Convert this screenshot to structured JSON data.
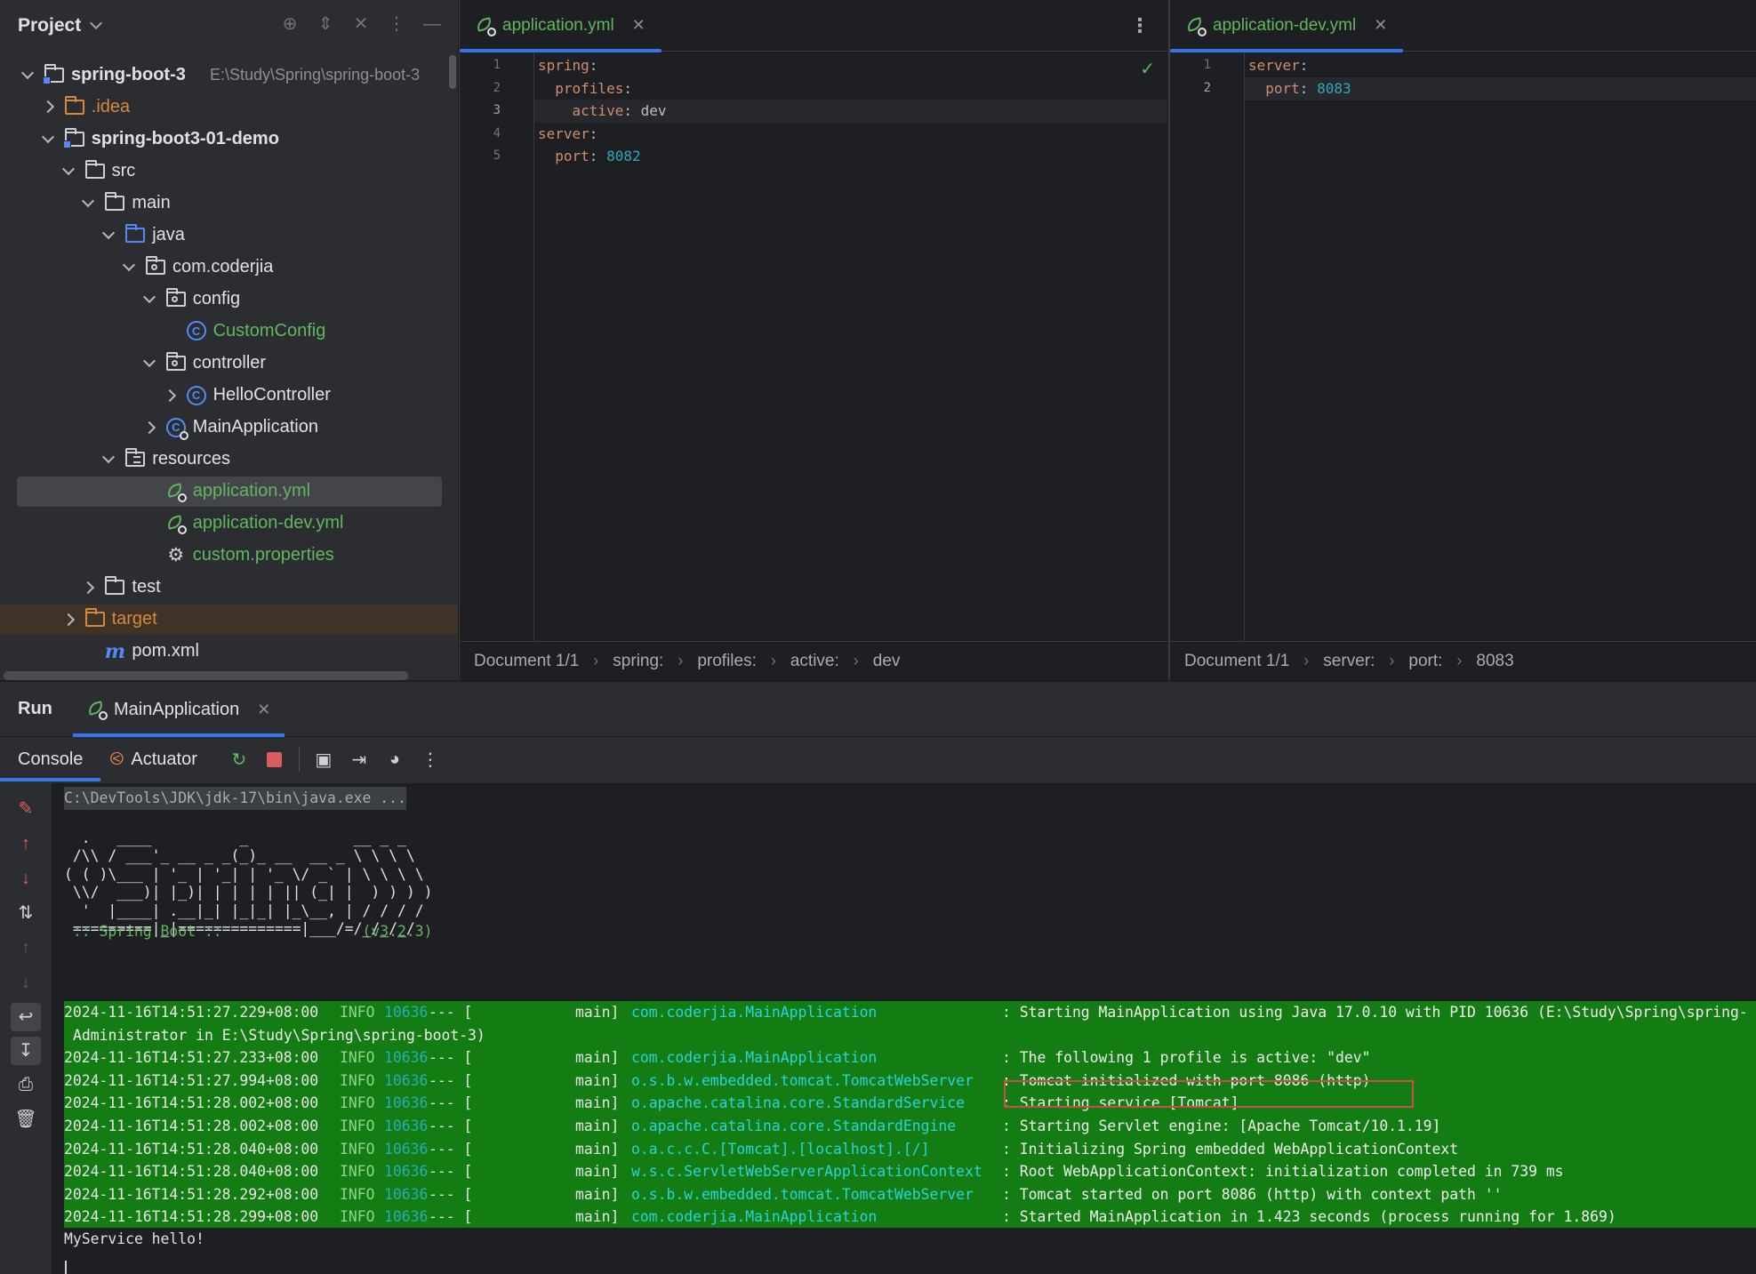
{
  "project": {
    "title": "Project",
    "tree": [
      {
        "label": "spring-boot-3",
        "hint": "E:\\Study\\Spring\\spring-boot-3",
        "depth": 0,
        "arrow": "down",
        "icon": "module-folder-icon",
        "color": "#dfe1e5",
        "bold": true
      },
      {
        "label": ".idea",
        "depth": 1,
        "arrow": "right",
        "icon": "folder-icon",
        "color": "#d5893c"
      },
      {
        "label": "spring-boot3-01-demo",
        "depth": 1,
        "arrow": "down",
        "icon": "module-folder-icon",
        "color": "#dfe1e5",
        "bold": true
      },
      {
        "label": "src",
        "depth": 2,
        "arrow": "down",
        "icon": "folder-icon",
        "color": "#dfe1e5"
      },
      {
        "label": "main",
        "depth": 3,
        "arrow": "down",
        "icon": "folder-icon",
        "color": "#dfe1e5"
      },
      {
        "label": "java",
        "depth": 4,
        "arrow": "down",
        "icon": "source-folder-icon",
        "color": "#dfe1e5"
      },
      {
        "label": "com.coderjia",
        "depth": 5,
        "arrow": "down",
        "icon": "package-icon",
        "color": "#dfe1e5"
      },
      {
        "label": "config",
        "depth": 6,
        "arrow": "down",
        "icon": "package-icon",
        "color": "#dfe1e5"
      },
      {
        "label": "CustomConfig",
        "depth": 7,
        "arrow": "",
        "icon": "class-icon",
        "color": "#5fb85f"
      },
      {
        "label": "controller",
        "depth": 6,
        "arrow": "down",
        "icon": "package-icon",
        "color": "#dfe1e5"
      },
      {
        "label": "HelloController",
        "depth": 7,
        "arrow": "right",
        "icon": "class-icon",
        "color": "#dfe1e5"
      },
      {
        "label": "MainApplication",
        "depth": 6,
        "arrow": "right",
        "icon": "spring-boot-class-icon",
        "color": "#dfe1e5"
      },
      {
        "label": "resources",
        "depth": 4,
        "arrow": "down",
        "icon": "resources-folder-icon",
        "color": "#dfe1e5"
      },
      {
        "label": "application.yml",
        "depth": 6,
        "arrow": "",
        "icon": "spring-yaml-icon",
        "color": "#5fb85f",
        "selected": true
      },
      {
        "label": "application-dev.yml",
        "depth": 6,
        "arrow": "",
        "icon": "spring-yaml-icon",
        "color": "#5fb85f"
      },
      {
        "label": "custom.properties",
        "depth": 6,
        "arrow": "",
        "icon": "gear-icon",
        "color": "#5fb85f"
      },
      {
        "label": "test",
        "depth": 3,
        "arrow": "right",
        "icon": "folder-icon",
        "color": "#dfe1e5"
      },
      {
        "label": "target",
        "depth": 2,
        "arrow": "right",
        "icon": "excluded-folder-icon",
        "color": "#d5893c",
        "excluded": true
      },
      {
        "label": "pom.xml",
        "depth": 3,
        "arrow": "",
        "icon": "maven-icon",
        "color": "#dfe1e5"
      }
    ]
  },
  "editor1": {
    "tab_label": "application.yml",
    "lines": [
      [
        {
          "t": "spring",
          "c": "k"
        },
        {
          "t": ":",
          "c": "p"
        }
      ],
      [
        {
          "t": "  profiles",
          "c": "k"
        },
        {
          "t": ":",
          "c": "p"
        }
      ],
      [
        {
          "t": "    active",
          "c": "k"
        },
        {
          "t": ": ",
          "c": "p"
        },
        {
          "t": "dev",
          "c": "v"
        }
      ],
      [
        {
          "t": "server",
          "c": "k"
        },
        {
          "t": ":",
          "c": "p"
        }
      ],
      [
        {
          "t": "  port",
          "c": "k"
        },
        {
          "t": ": ",
          "c": "p"
        },
        {
          "t": "8082",
          "c": "n"
        }
      ]
    ],
    "current_line": 3,
    "breadcrumbs": [
      "Document 1/1",
      "spring:",
      "profiles:",
      "active:",
      "dev"
    ]
  },
  "editor2": {
    "tab_label": "application-dev.yml",
    "lines": [
      [
        {
          "t": "server",
          "c": "k"
        },
        {
          "t": ":",
          "c": "p"
        }
      ],
      [
        {
          "t": "  port",
          "c": "k"
        },
        {
          "t": ": ",
          "c": "p"
        },
        {
          "t": "8083",
          "c": "n"
        }
      ]
    ],
    "current_line": 2,
    "breadcrumbs": [
      "Document 1/1",
      "server:",
      "port:",
      "8083"
    ]
  },
  "run": {
    "title": "Run",
    "config_tab": "MainApplication",
    "console_tab": "Console",
    "actuator_tab": "Actuator",
    "command": "C:\\DevTools\\JDK\\jdk-17\\bin\\java.exe ...",
    "banner": [
      "  .   ____          _            __ _ _",
      " /\\\\ / ___'_ __ _ _(_)_ __  __ _ \\ \\ \\ \\",
      "( ( )\\___ | '_ | '_| | '_ \\/ _` | \\ \\ \\ \\",
      " \\\\/  ___)| |_)| | | | | || (_| |  ) ) ) )",
      "  '  |____| .__|_| |_|_| |_\\__, | / / / /",
      " =========|_|==============|___/=/_/_/_/"
    ],
    "boot_line": " :: Spring Boot ::                (v3.2.3)",
    "logs": [
      {
        "ts": "2024-11-16T14:51:27.229+08:00",
        "level": "INFO",
        "pid": "10636",
        "dash": "--- [",
        "thread": "main]",
        "logger": "com.coderjia.MainApplication",
        "msg": ": Starting MainApplication using Java 17.0.10 with PID 10636 (E:\\Study\\Spring\\spring-",
        "cont": "Administrator in E:\\Study\\Spring\\spring-boot-3)"
      },
      {
        "ts": "2024-11-16T14:51:27.233+08:00",
        "level": "INFO",
        "pid": "10636",
        "dash": "--- [",
        "thread": "main]",
        "logger": "com.coderjia.MainApplication",
        "msg": ": The following 1 profile is active: \"dev\""
      },
      {
        "ts": "2024-11-16T14:51:27.994+08:00",
        "level": "INFO",
        "pid": "10636",
        "dash": "--- [",
        "thread": "main]",
        "logger": "o.s.b.w.embedded.tomcat.TomcatWebServer",
        "msg": ": Tomcat initialized with port 8086 (http)"
      },
      {
        "ts": "2024-11-16T14:51:28.002+08:00",
        "level": "INFO",
        "pid": "10636",
        "dash": "--- [",
        "thread": "main]",
        "logger": "o.apache.catalina.core.StandardService",
        "msg": ": Starting service [Tomcat]"
      },
      {
        "ts": "2024-11-16T14:51:28.002+08:00",
        "level": "INFO",
        "pid": "10636",
        "dash": "--- [",
        "thread": "main]",
        "logger": "o.apache.catalina.core.StandardEngine",
        "msg": ": Starting Servlet engine: [Apache Tomcat/10.1.19]"
      },
      {
        "ts": "2024-11-16T14:51:28.040+08:00",
        "level": "INFO",
        "pid": "10636",
        "dash": "--- [",
        "thread": "main]",
        "logger": "o.a.c.c.C.[Tomcat].[localhost].[/]",
        "msg": ": Initializing Spring embedded WebApplicationContext"
      },
      {
        "ts": "2024-11-16T14:51:28.040+08:00",
        "level": "INFO",
        "pid": "10636",
        "dash": "--- [",
        "thread": "main]",
        "logger": "w.s.c.ServletWebServerApplicationContext",
        "msg": ": Root WebApplicationContext: initialization completed in 739 ms"
      },
      {
        "ts": "2024-11-16T14:51:28.292+08:00",
        "level": "INFO",
        "pid": "10636",
        "dash": "--- [",
        "thread": "main]",
        "logger": "o.s.b.w.embedded.tomcat.TomcatWebServer",
        "msg": ": Tomcat started on port 8086 (http) with context path ''"
      },
      {
        "ts": "2024-11-16T14:51:28.299+08:00",
        "level": "INFO",
        "pid": "10636",
        "dash": "--- [",
        "thread": "main]",
        "logger": "com.coderjia.MainApplication",
        "msg": ": Started MainApplication in 1.423 seconds (process running for 1.869)"
      }
    ],
    "output": "MyService hello!"
  },
  "colors": {
    "accent": "#3574f0",
    "spring_green": "#5fb85f",
    "log_background": "#137c13",
    "highlight_box": "#d04a4a"
  }
}
